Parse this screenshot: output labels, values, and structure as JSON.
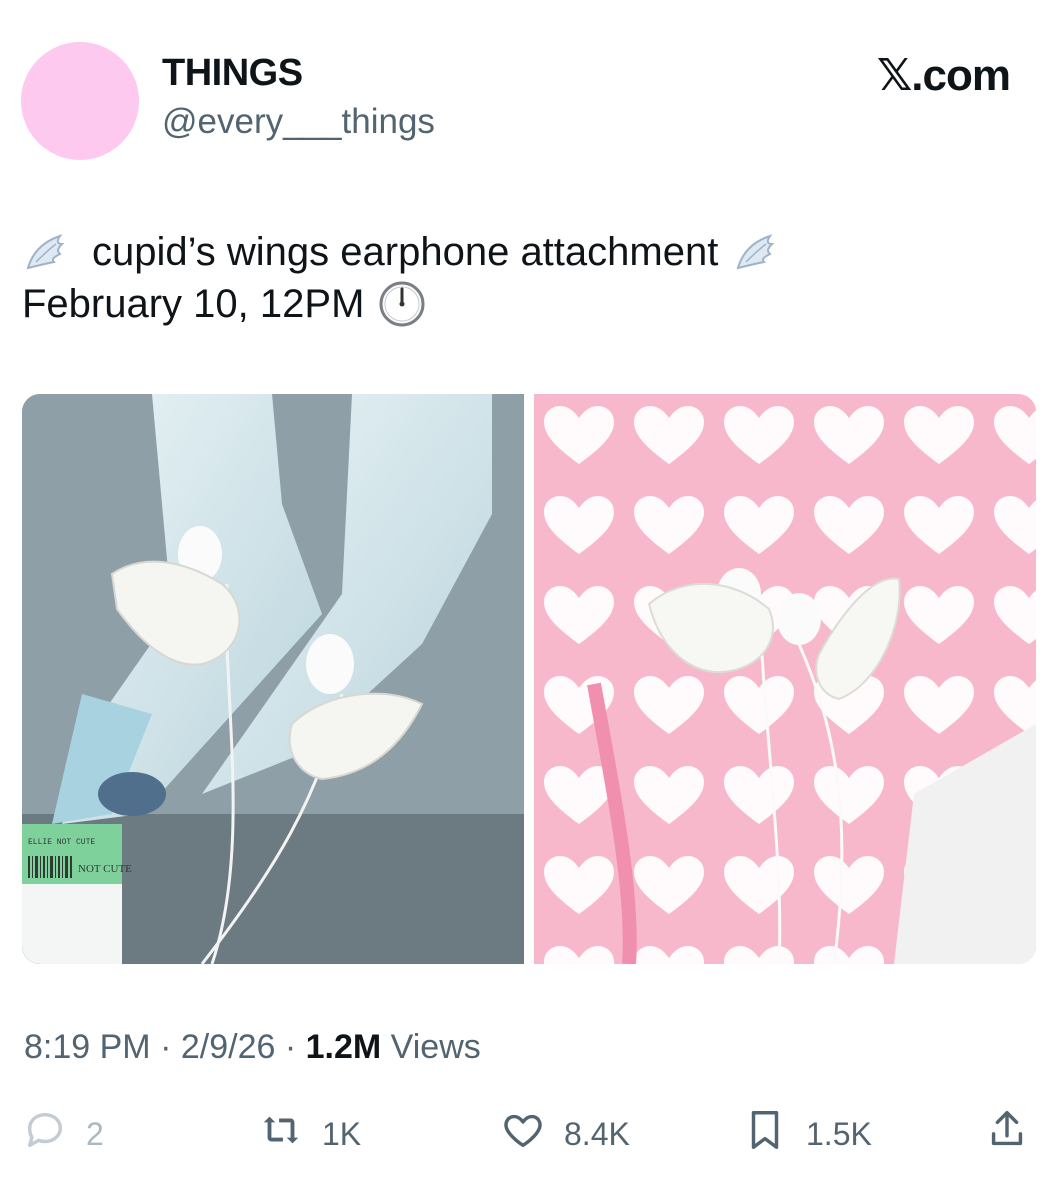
{
  "header": {
    "display_name": "THINGS",
    "handle": "@every___things",
    "brand": "𝕏.com"
  },
  "avatar": {
    "color": "#fec9ee"
  },
  "tweet": {
    "line1": "cupid’s wings earphone attachment",
    "line2": "February 10, 12PM",
    "icons": [
      "wing-icon",
      "clock-icon"
    ]
  },
  "media": {
    "photos": [
      {
        "name": "earphones-on-shoes-photo",
        "label_top": "ELLIE NOT CUTE",
        "label_mid": "NOT CUTE"
      },
      {
        "name": "earphones-on-pink-bag-photo"
      }
    ]
  },
  "meta": {
    "time": "8:19 PM",
    "sep1": "·",
    "date": "2/9/26",
    "sep2": "·",
    "views_count": "1.2M",
    "views_label": "Views"
  },
  "actions": {
    "reply_count": "2",
    "repost_count": "1K",
    "like_count": "8.4K",
    "bookmark_count": "1.5K"
  }
}
